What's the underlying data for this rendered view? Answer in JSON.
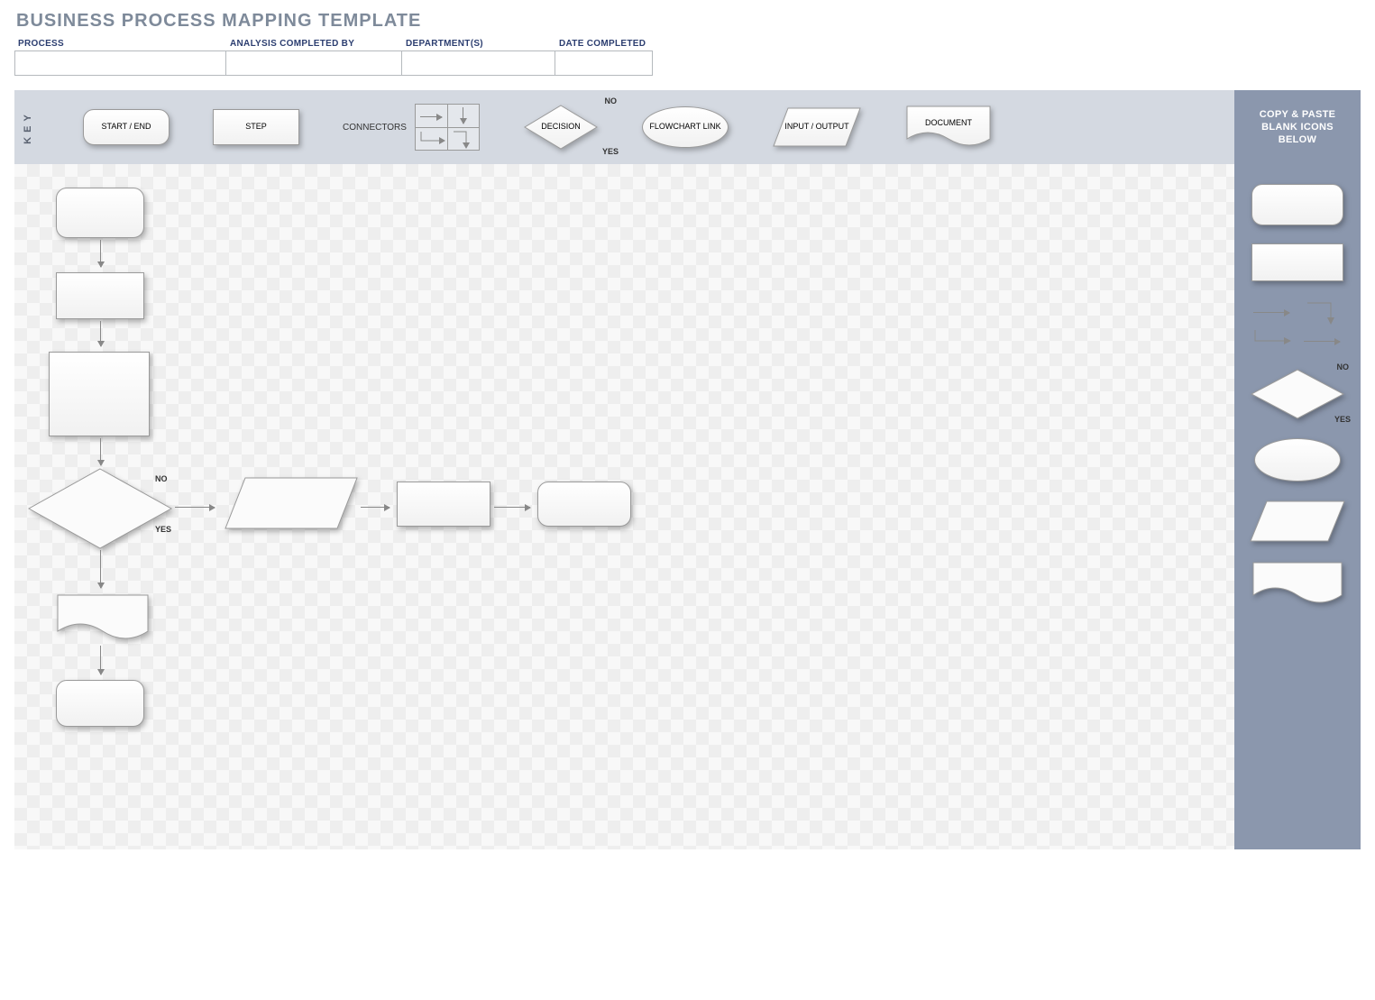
{
  "title": "BUSINESS PROCESS MAPPING TEMPLATE",
  "meta": {
    "process_label": "PROCESS",
    "process_value": "",
    "analysis_label": "ANALYSIS COMPLETED BY",
    "analysis_value": "",
    "department_label": "DEPARTMENT(S)",
    "department_value": "",
    "date_label": "DATE COMPLETED",
    "date_value": ""
  },
  "key": {
    "tab": "KEY",
    "start_end": "START / END",
    "step": "STEP",
    "connectors": "CONNECTORS",
    "decision": "DECISION",
    "decision_no": "NO",
    "decision_yes": "YES",
    "flowchart_link": "FLOWCHART LINK",
    "input_output": "INPUT / OUTPUT",
    "document": "DOCUMENT"
  },
  "paste_header": "COPY & PASTE BLANK ICONS BELOW",
  "canvas": {
    "no": "NO",
    "yes": "YES"
  },
  "palette": {
    "no": "NO",
    "yes": "YES"
  }
}
